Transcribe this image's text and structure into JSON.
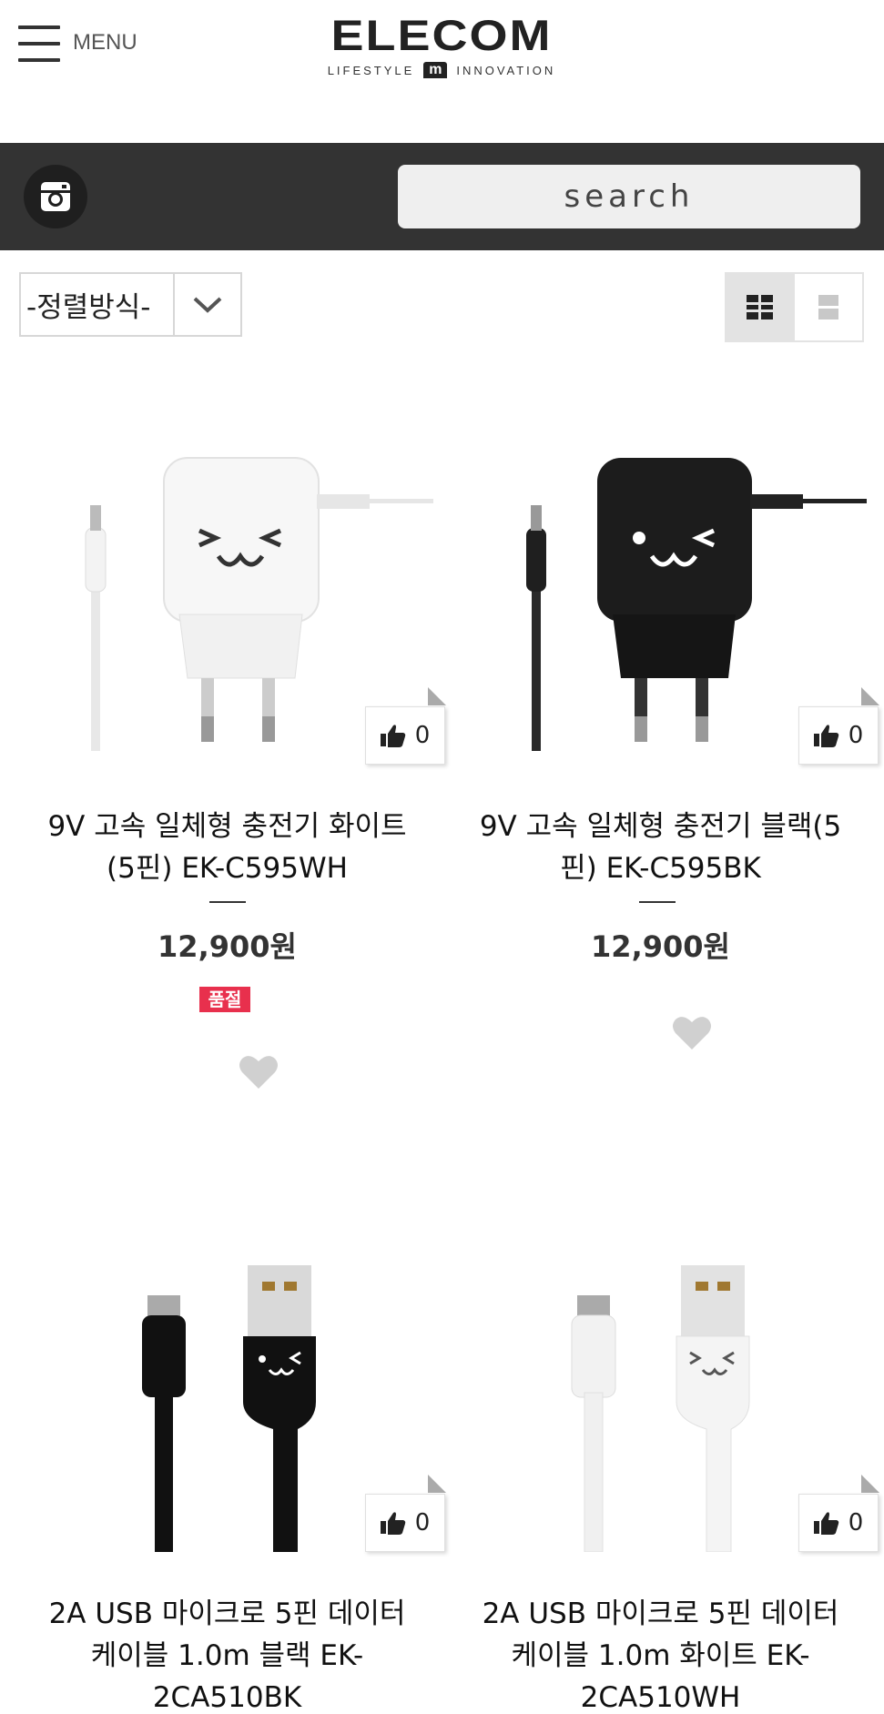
{
  "header": {
    "menu_label": "MENU",
    "logo_text": "ELECOM",
    "logo_tagline_left": "LIFESTYLE",
    "logo_tagline_right": "INNOVATION"
  },
  "topbar": {
    "search_placeholder": "search"
  },
  "toolbar": {
    "sort_label": "-정렬방식-",
    "view_mode": "grid"
  },
  "products": [
    {
      "name": "9V 고속 일체형 충전기 화이트(5핀) EK-C595WH",
      "name_line1": "9V 고속 일체형 충전기 화이트",
      "name_line2": "(5핀) EK-C595WH",
      "price": "12,900원",
      "likes": "0",
      "badge": "품절",
      "color": "white"
    },
    {
      "name": "9V 고속 일체형 충전기 블랙(5핀) EK-C595BK",
      "name_line1": "9V 고속 일체형 충전기 블랙(5",
      "name_line2": "핀) EK-C595BK",
      "price": "12,900원",
      "likes": "0",
      "color": "black"
    },
    {
      "name": "2A USB 마이크로 5핀 데이터 케이블 1.0m 블랙 EK-2CA510BK",
      "name_line1": "2A USB 마이크로 5핀 데이터",
      "name_line2": "케이블 1.0m 블랙 EK-",
      "name_line3": "2CA510BK",
      "likes": "0",
      "color": "black"
    },
    {
      "name": "2A USB 마이크로 5핀 데이터 케이블 1.0m 화이트 EK-2CA510WH",
      "name_line1": "2A USB 마이크로 5핀 데이터",
      "name_line2": "케이블 1.0m 화이트 EK-",
      "name_line3": "2CA510WH",
      "likes": "0",
      "color": "white"
    }
  ],
  "icons": {
    "menu": "hamburger-icon",
    "instagram": "instagram-icon",
    "sort": "chevron-down-icon",
    "grid": "grid-view-icon",
    "list": "list-view-icon",
    "like": "thumbs-up-icon",
    "wishlist": "heart-icon"
  },
  "colors": {
    "topbar": "#333333",
    "soldout_badge": "#e8304d",
    "heart": "#d0d0d0"
  }
}
